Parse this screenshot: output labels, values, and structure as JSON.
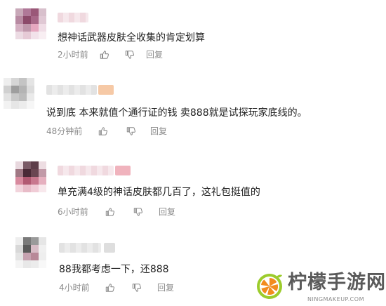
{
  "comments": [
    {
      "text": "想神话武器皮肤全收集的肯定划算",
      "time": "2小时前",
      "reply_label": "回复",
      "name_style": "pink"
    },
    {
      "text": "说到底 本来就值个通行证的钱 卖888就是试探玩家底线的。",
      "time": "48分钟前",
      "reply_label": "回复",
      "name_style": "gray"
    },
    {
      "text": "单充满4级的神话皮肤都几百了，这礼包挺值的",
      "time": "6小时前",
      "reply_label": "回复",
      "name_style": "pink"
    },
    {
      "text": "88我都考虑一下，还888",
      "time": "4小时前",
      "reply_label": "回复",
      "name_style": "gray"
    }
  ],
  "icons": {
    "like": "thumbs-up-icon",
    "dislike": "thumbs-down-icon"
  },
  "watermark": {
    "title": "柠檬手游网",
    "subtitle": "NINGMAKEUP.COM",
    "accent_color": "#f28c1e",
    "lime_color": "#9ccc2c"
  },
  "colors": {
    "text": "#222222",
    "meta": "#8a8a8a"
  }
}
